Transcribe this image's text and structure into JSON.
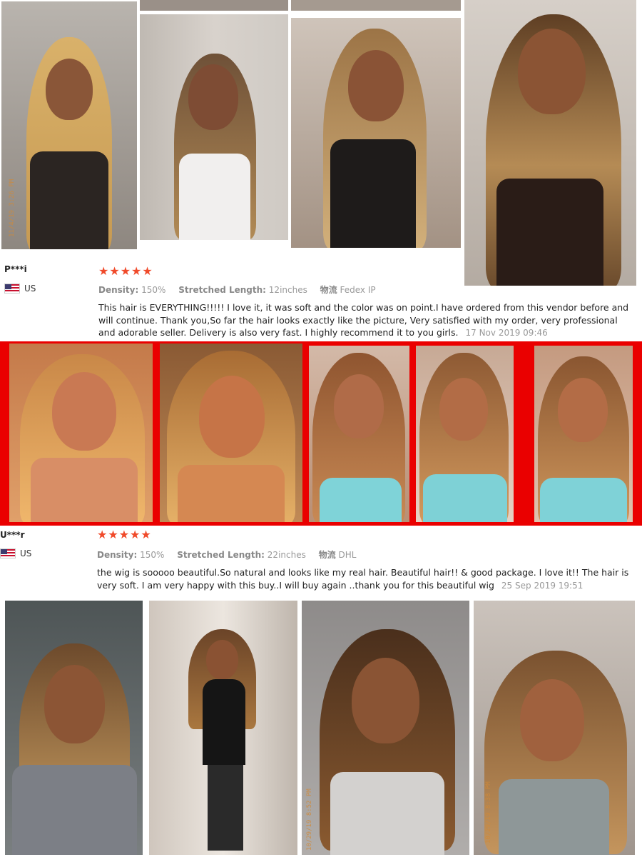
{
  "reviews": [
    {
      "user": "P***i",
      "country": "US",
      "rating": "★★★★★",
      "density_label": "Density:",
      "density_value": "150%",
      "length_label": "Stretched Length:",
      "length_value": "12inches",
      "ship_label": "物流",
      "ship_value": "Fedex IP",
      "text": "This hair is EVERYTHING!!!!! I love it, it was soft and the color was on point.I have ordered from this vendor before and will continue. Thank you,So far the hair looks exactly like the picture, Very satisfied with my order, very professional and adorable seller. Delivery is also very fast. I highly recommend it to you girls.",
      "date": "17 Nov 2019 09:46"
    },
    {
      "user": "U***r",
      "country": "US",
      "rating": "★★★★★",
      "density_label": "Density:",
      "density_value": "150%",
      "length_label": "Stretched Length:",
      "length_value": "22inches",
      "ship_label": "物流",
      "ship_value": "DHL",
      "text": "the wig is sooooo beautiful.So natural and looks like my real hair. Beautiful hair!! & good package. I love it!! The hair is very soft. I am very happy with this buy..I will buy again ..thank you for this beautiful wig",
      "date": "25 Sep 2019 19:51"
    }
  ],
  "photo_stamps": {
    "p1": "11/4/19 3:26 PM",
    "p12": "10/29/19 8:52 PM",
    "p13": "10/29/19 8:38 PM"
  },
  "colors": {
    "star": "#f04a2a",
    "band": "#ea0000",
    "meta": "#999999"
  },
  "icons": [
    "us-flag-icon",
    "star-icon"
  ]
}
